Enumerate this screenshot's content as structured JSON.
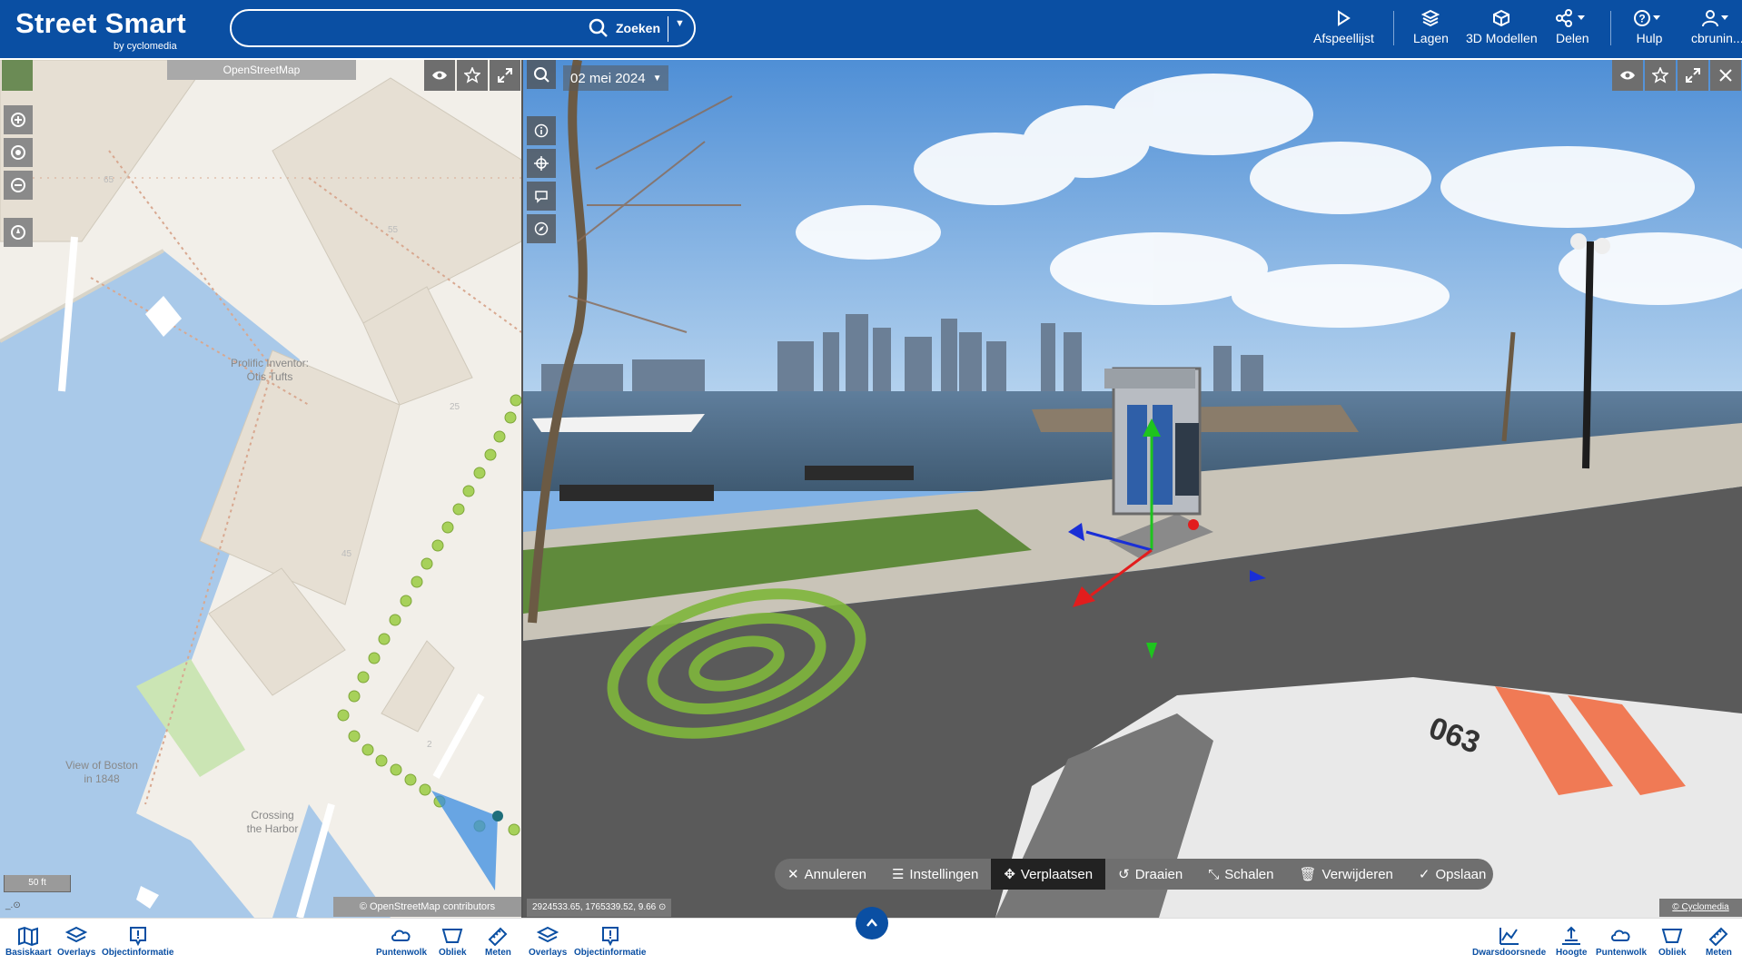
{
  "app": {
    "logo_main": "Street Smart",
    "logo_sub": "by cyclomedia"
  },
  "search": {
    "value": "",
    "button_label": "Zoeken"
  },
  "toolbar": {
    "playlist": "Afspeellijst",
    "layers": "Lagen",
    "models3d": "3D Modellen",
    "share": "Delen",
    "help": "Hulp",
    "user": "cbrunin..."
  },
  "map": {
    "source_label": "OpenStreetMap",
    "attribution": "© OpenStreetMap contributors",
    "scale": "50 ft",
    "labels": {
      "b65": "65",
      "b55": "55",
      "b25": "25",
      "b45": "45",
      "b2": "2",
      "inventor1": "Prolific Inventor:",
      "inventor2": "Otis Tufts",
      "view1": "View of Boston",
      "view2": "in 1848",
      "crossing1": "Crossing",
      "crossing2": "the Harbor"
    }
  },
  "pano": {
    "date": "02 mei 2024",
    "coords": "2924533.65, 1765339.52, 9.66",
    "copyright": "© Cyclomedia",
    "vehicle_number": "063"
  },
  "edit_toolbar": {
    "cancel": "Annuleren",
    "settings": "Instellingen",
    "move": "Verplaatsen",
    "rotate": "Draaien",
    "scale": "Schalen",
    "delete": "Verwijderen",
    "save": "Opslaan"
  },
  "bottom_left": {
    "basemap": "Basiskaart",
    "overlays": "Overlays",
    "objectinfo": "Objectinformatie",
    "pointcloud": "Puntenwolk",
    "oblique": "Obliek",
    "measure": "Meten"
  },
  "bottom_right": {
    "overlays": "Overlays",
    "objectinfo": "Objectinformatie",
    "crosssection": "Dwarsdoorsnede",
    "height": "Hoogte",
    "pointcloud": "Puntenwolk",
    "oblique": "Obliek",
    "measure": "Meten"
  },
  "colors": {
    "brand": "#0a4fa3",
    "water": "#a9c9e9",
    "grass": "#7fb63b"
  }
}
